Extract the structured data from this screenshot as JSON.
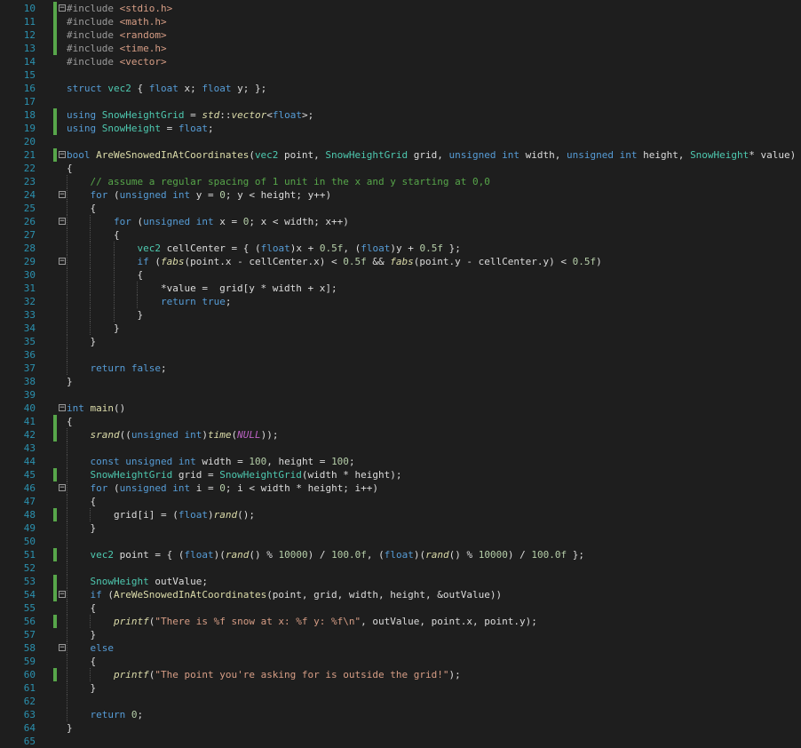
{
  "editor": {
    "language": "C++",
    "theme": {
      "background": "#1e1e1e",
      "line_number": "#2b91af",
      "change_bar": "#57a64a"
    },
    "lines": [
      {
        "n": "10",
        "chg": true,
        "fold": "minus",
        "indent": 0,
        "tokens": [
          [
            "pp",
            "#include "
          ],
          [
            "st",
            "<stdio.h>"
          ]
        ]
      },
      {
        "n": "11",
        "chg": true,
        "fold": "",
        "indent": 0,
        "tokens": [
          [
            "pp",
            "#include "
          ],
          [
            "st",
            "<math.h>"
          ]
        ]
      },
      {
        "n": "12",
        "chg": true,
        "fold": "",
        "indent": 0,
        "tokens": [
          [
            "pp",
            "#include "
          ],
          [
            "st",
            "<random>"
          ]
        ]
      },
      {
        "n": "13",
        "chg": true,
        "fold": "",
        "indent": 0,
        "tokens": [
          [
            "pp",
            "#include "
          ],
          [
            "st",
            "<time.h>"
          ]
        ]
      },
      {
        "n": "14",
        "chg": false,
        "fold": "",
        "indent": 0,
        "tokens": [
          [
            "pp",
            "#include "
          ],
          [
            "st",
            "<vector>"
          ]
        ]
      },
      {
        "n": "15",
        "chg": false,
        "fold": "",
        "indent": 0,
        "tokens": []
      },
      {
        "n": "16",
        "chg": false,
        "fold": "",
        "indent": 0,
        "tokens": [
          [
            "kw",
            "struct "
          ],
          [
            "ty",
            "vec2"
          ],
          [
            "pl",
            " { "
          ],
          [
            "kw",
            "float"
          ],
          [
            "pl",
            " x; "
          ],
          [
            "kw",
            "float"
          ],
          [
            "pl",
            " y; };"
          ]
        ]
      },
      {
        "n": "17",
        "chg": false,
        "fold": "",
        "indent": 0,
        "tokens": []
      },
      {
        "n": "18",
        "chg": true,
        "fold": "",
        "indent": 0,
        "tokens": [
          [
            "kw",
            "using "
          ],
          [
            "ty",
            "SnowHeightGrid"
          ],
          [
            "pl",
            " = "
          ],
          [
            "it",
            "std"
          ],
          [
            "pl",
            "::"
          ],
          [
            "it",
            "vector"
          ],
          [
            "pl",
            "<"
          ],
          [
            "kw",
            "float"
          ],
          [
            "pl",
            ">;"
          ]
        ]
      },
      {
        "n": "19",
        "chg": true,
        "fold": "",
        "indent": 0,
        "tokens": [
          [
            "kw",
            "using "
          ],
          [
            "ty",
            "SnowHeight"
          ],
          [
            "pl",
            " = "
          ],
          [
            "kw",
            "float"
          ],
          [
            "pl",
            ";"
          ]
        ]
      },
      {
        "n": "20",
        "chg": false,
        "fold": "",
        "indent": 0,
        "tokens": []
      },
      {
        "n": "21",
        "chg": true,
        "fold": "minus",
        "indent": 0,
        "tokens": [
          [
            "kw",
            "bool "
          ],
          [
            "fn",
            "AreWeSnowedInAtCoordinates"
          ],
          [
            "pl",
            "("
          ],
          [
            "ty",
            "vec2"
          ],
          [
            "pl",
            " point, "
          ],
          [
            "ty",
            "SnowHeightGrid"
          ],
          [
            "pl",
            " grid, "
          ],
          [
            "kw",
            "unsigned int"
          ],
          [
            "pl",
            " width, "
          ],
          [
            "kw",
            "unsigned int"
          ],
          [
            "pl",
            " height, "
          ],
          [
            "ty",
            "SnowHeight"
          ],
          [
            "pl",
            "* value)"
          ]
        ]
      },
      {
        "n": "22",
        "chg": false,
        "fold": "",
        "indent": 0,
        "tokens": [
          [
            "pl",
            "{"
          ]
        ]
      },
      {
        "n": "23",
        "chg": false,
        "fold": "",
        "indent": 1,
        "tokens": [
          [
            "pl",
            "    "
          ],
          [
            "cm",
            "// assume a regular spacing of 1 unit in the x and y starting at 0,0"
          ]
        ]
      },
      {
        "n": "24",
        "chg": false,
        "fold": "minus",
        "indent": 1,
        "tokens": [
          [
            "pl",
            "    "
          ],
          [
            "kw",
            "for"
          ],
          [
            "pl",
            " ("
          ],
          [
            "kw",
            "unsigned int"
          ],
          [
            "pl",
            " y = "
          ],
          [
            "nm",
            "0"
          ],
          [
            "pl",
            "; y < height; y++)"
          ]
        ]
      },
      {
        "n": "25",
        "chg": false,
        "fold": "",
        "indent": 1,
        "tokens": [
          [
            "pl",
            "    {"
          ]
        ]
      },
      {
        "n": "26",
        "chg": false,
        "fold": "minus",
        "indent": 2,
        "tokens": [
          [
            "pl",
            "        "
          ],
          [
            "kw",
            "for"
          ],
          [
            "pl",
            " ("
          ],
          [
            "kw",
            "unsigned int"
          ],
          [
            "pl",
            " x = "
          ],
          [
            "nm",
            "0"
          ],
          [
            "pl",
            "; x < width; x++)"
          ]
        ]
      },
      {
        "n": "27",
        "chg": false,
        "fold": "",
        "indent": 2,
        "tokens": [
          [
            "pl",
            "        {"
          ]
        ]
      },
      {
        "n": "28",
        "chg": false,
        "fold": "",
        "indent": 3,
        "tokens": [
          [
            "pl",
            "            "
          ],
          [
            "ty",
            "vec2"
          ],
          [
            "pl",
            " cellCenter = { ("
          ],
          [
            "kw",
            "float"
          ],
          [
            "pl",
            ")x + "
          ],
          [
            "nm",
            "0.5f"
          ],
          [
            "pl",
            ", ("
          ],
          [
            "kw",
            "float"
          ],
          [
            "pl",
            ")y + "
          ],
          [
            "nm",
            "0.5f"
          ],
          [
            "pl",
            " };"
          ]
        ]
      },
      {
        "n": "29",
        "chg": false,
        "fold": "minus",
        "indent": 3,
        "tokens": [
          [
            "pl",
            "            "
          ],
          [
            "kw",
            "if"
          ],
          [
            "pl",
            " ("
          ],
          [
            "it",
            "fabs"
          ],
          [
            "pl",
            "(point.x - cellCenter.x) < "
          ],
          [
            "nm",
            "0.5f"
          ],
          [
            "pl",
            " && "
          ],
          [
            "it",
            "fabs"
          ],
          [
            "pl",
            "(point.y - cellCenter.y) < "
          ],
          [
            "nm",
            "0.5f"
          ],
          [
            "pl",
            ")"
          ]
        ]
      },
      {
        "n": "30",
        "chg": false,
        "fold": "",
        "indent": 3,
        "tokens": [
          [
            "pl",
            "            {"
          ]
        ]
      },
      {
        "n": "31",
        "chg": false,
        "fold": "",
        "indent": 4,
        "tokens": [
          [
            "pl",
            "                *value =  grid[y * width + x];"
          ]
        ]
      },
      {
        "n": "32",
        "chg": false,
        "fold": "",
        "indent": 4,
        "tokens": [
          [
            "pl",
            "                "
          ],
          [
            "kw",
            "return true"
          ],
          [
            "pl",
            ";"
          ]
        ]
      },
      {
        "n": "33",
        "chg": false,
        "fold": "",
        "indent": 3,
        "tokens": [
          [
            "pl",
            "            }"
          ]
        ]
      },
      {
        "n": "34",
        "chg": false,
        "fold": "",
        "indent": 2,
        "tokens": [
          [
            "pl",
            "        }"
          ]
        ]
      },
      {
        "n": "35",
        "chg": false,
        "fold": "",
        "indent": 1,
        "tokens": [
          [
            "pl",
            "    }"
          ]
        ]
      },
      {
        "n": "36",
        "chg": false,
        "fold": "",
        "indent": 1,
        "tokens": []
      },
      {
        "n": "37",
        "chg": false,
        "fold": "",
        "indent": 1,
        "tokens": [
          [
            "pl",
            "    "
          ],
          [
            "kw",
            "return false"
          ],
          [
            "pl",
            ";"
          ]
        ]
      },
      {
        "n": "38",
        "chg": false,
        "fold": "",
        "indent": 0,
        "tokens": [
          [
            "pl",
            "}"
          ]
        ]
      },
      {
        "n": "39",
        "chg": false,
        "fold": "",
        "indent": 0,
        "tokens": []
      },
      {
        "n": "40",
        "chg": false,
        "fold": "minus",
        "indent": 0,
        "tokens": [
          [
            "kw",
            "int "
          ],
          [
            "fn",
            "main"
          ],
          [
            "pl",
            "()"
          ]
        ]
      },
      {
        "n": "41",
        "chg": true,
        "fold": "",
        "indent": 0,
        "tokens": [
          [
            "pl",
            "{"
          ]
        ]
      },
      {
        "n": "42",
        "chg": true,
        "fold": "",
        "indent": 1,
        "tokens": [
          [
            "pl",
            "    "
          ],
          [
            "it",
            "srand"
          ],
          [
            "pl",
            "(("
          ],
          [
            "kw",
            "unsigned int"
          ],
          [
            "pl",
            ")"
          ],
          [
            "it",
            "time"
          ],
          [
            "pl",
            "("
          ],
          [
            "mc",
            "NULL"
          ],
          [
            "pl",
            "));"
          ]
        ]
      },
      {
        "n": "43",
        "chg": false,
        "fold": "",
        "indent": 1,
        "tokens": []
      },
      {
        "n": "44",
        "chg": false,
        "fold": "",
        "indent": 1,
        "tokens": [
          [
            "pl",
            "    "
          ],
          [
            "kw",
            "const unsigned int"
          ],
          [
            "pl",
            " width = "
          ],
          [
            "nm",
            "100"
          ],
          [
            "pl",
            ", height = "
          ],
          [
            "nm",
            "100"
          ],
          [
            "pl",
            ";"
          ]
        ]
      },
      {
        "n": "45",
        "chg": true,
        "fold": "",
        "indent": 1,
        "tokens": [
          [
            "pl",
            "    "
          ],
          [
            "ty",
            "SnowHeightGrid"
          ],
          [
            "pl",
            " grid = "
          ],
          [
            "ty",
            "SnowHeightGrid"
          ],
          [
            "pl",
            "(width * height);"
          ]
        ]
      },
      {
        "n": "46",
        "chg": false,
        "fold": "minus",
        "indent": 1,
        "tokens": [
          [
            "pl",
            "    "
          ],
          [
            "kw",
            "for"
          ],
          [
            "pl",
            " ("
          ],
          [
            "kw",
            "unsigned int"
          ],
          [
            "pl",
            " i = "
          ],
          [
            "nm",
            "0"
          ],
          [
            "pl",
            "; i < width * height; i++)"
          ]
        ]
      },
      {
        "n": "47",
        "chg": false,
        "fold": "",
        "indent": 1,
        "tokens": [
          [
            "pl",
            "    {"
          ]
        ]
      },
      {
        "n": "48",
        "chg": true,
        "fold": "",
        "indent": 2,
        "tokens": [
          [
            "pl",
            "        grid[i] = ("
          ],
          [
            "kw",
            "float"
          ],
          [
            "pl",
            ")"
          ],
          [
            "it",
            "rand"
          ],
          [
            "pl",
            "();"
          ]
        ]
      },
      {
        "n": "49",
        "chg": false,
        "fold": "",
        "indent": 1,
        "tokens": [
          [
            "pl",
            "    }"
          ]
        ]
      },
      {
        "n": "50",
        "chg": false,
        "fold": "",
        "indent": 1,
        "tokens": []
      },
      {
        "n": "51",
        "chg": true,
        "fold": "",
        "indent": 1,
        "tokens": [
          [
            "pl",
            "    "
          ],
          [
            "ty",
            "vec2"
          ],
          [
            "pl",
            " point = { ("
          ],
          [
            "kw",
            "float"
          ],
          [
            "pl",
            ")("
          ],
          [
            "it",
            "rand"
          ],
          [
            "pl",
            "() % "
          ],
          [
            "nm",
            "10000"
          ],
          [
            "pl",
            ") / "
          ],
          [
            "nm",
            "100.0f"
          ],
          [
            "pl",
            ", ("
          ],
          [
            "kw",
            "float"
          ],
          [
            "pl",
            ")("
          ],
          [
            "it",
            "rand"
          ],
          [
            "pl",
            "() % "
          ],
          [
            "nm",
            "10000"
          ],
          [
            "pl",
            ") / "
          ],
          [
            "nm",
            "100.0f"
          ],
          [
            "pl",
            " };"
          ]
        ]
      },
      {
        "n": "52",
        "chg": false,
        "fold": "",
        "indent": 1,
        "tokens": []
      },
      {
        "n": "53",
        "chg": true,
        "fold": "",
        "indent": 1,
        "tokens": [
          [
            "pl",
            "    "
          ],
          [
            "ty",
            "SnowHeight"
          ],
          [
            "pl",
            " outValue;"
          ]
        ]
      },
      {
        "n": "54",
        "chg": true,
        "fold": "minus",
        "indent": 1,
        "tokens": [
          [
            "pl",
            "    "
          ],
          [
            "kw",
            "if"
          ],
          [
            "pl",
            " ("
          ],
          [
            "fn",
            "AreWeSnowedInAtCoordinates"
          ],
          [
            "pl",
            "(point, grid, width, height, &outValue))"
          ]
        ]
      },
      {
        "n": "55",
        "chg": false,
        "fold": "",
        "indent": 1,
        "tokens": [
          [
            "pl",
            "    {"
          ]
        ]
      },
      {
        "n": "56",
        "chg": true,
        "fold": "",
        "indent": 2,
        "tokens": [
          [
            "pl",
            "        "
          ],
          [
            "it",
            "printf"
          ],
          [
            "pl",
            "("
          ],
          [
            "st",
            "\"There is %f snow at x: %f y: %f\\n\""
          ],
          [
            "pl",
            ", outValue, point.x, point.y);"
          ]
        ]
      },
      {
        "n": "57",
        "chg": false,
        "fold": "",
        "indent": 1,
        "tokens": [
          [
            "pl",
            "    }"
          ]
        ]
      },
      {
        "n": "58",
        "chg": false,
        "fold": "minus",
        "indent": 1,
        "tokens": [
          [
            "pl",
            "    "
          ],
          [
            "kw",
            "else"
          ]
        ]
      },
      {
        "n": "59",
        "chg": false,
        "fold": "",
        "indent": 1,
        "tokens": [
          [
            "pl",
            "    {"
          ]
        ]
      },
      {
        "n": "60",
        "chg": true,
        "fold": "",
        "indent": 2,
        "tokens": [
          [
            "pl",
            "        "
          ],
          [
            "it",
            "printf"
          ],
          [
            "pl",
            "("
          ],
          [
            "st",
            "\"The point you're asking for is outside the grid!\""
          ],
          [
            "pl",
            ");"
          ]
        ]
      },
      {
        "n": "61",
        "chg": false,
        "fold": "",
        "indent": 1,
        "tokens": [
          [
            "pl",
            "    }"
          ]
        ]
      },
      {
        "n": "62",
        "chg": false,
        "fold": "",
        "indent": 1,
        "tokens": []
      },
      {
        "n": "63",
        "chg": false,
        "fold": "",
        "indent": 1,
        "tokens": [
          [
            "pl",
            "    "
          ],
          [
            "kw",
            "return "
          ],
          [
            "nm",
            "0"
          ],
          [
            "pl",
            ";"
          ]
        ]
      },
      {
        "n": "64",
        "chg": false,
        "fold": "",
        "indent": 0,
        "tokens": [
          [
            "pl",
            "}"
          ]
        ]
      },
      {
        "n": "65",
        "chg": false,
        "fold": "",
        "indent": 0,
        "tokens": []
      }
    ]
  }
}
